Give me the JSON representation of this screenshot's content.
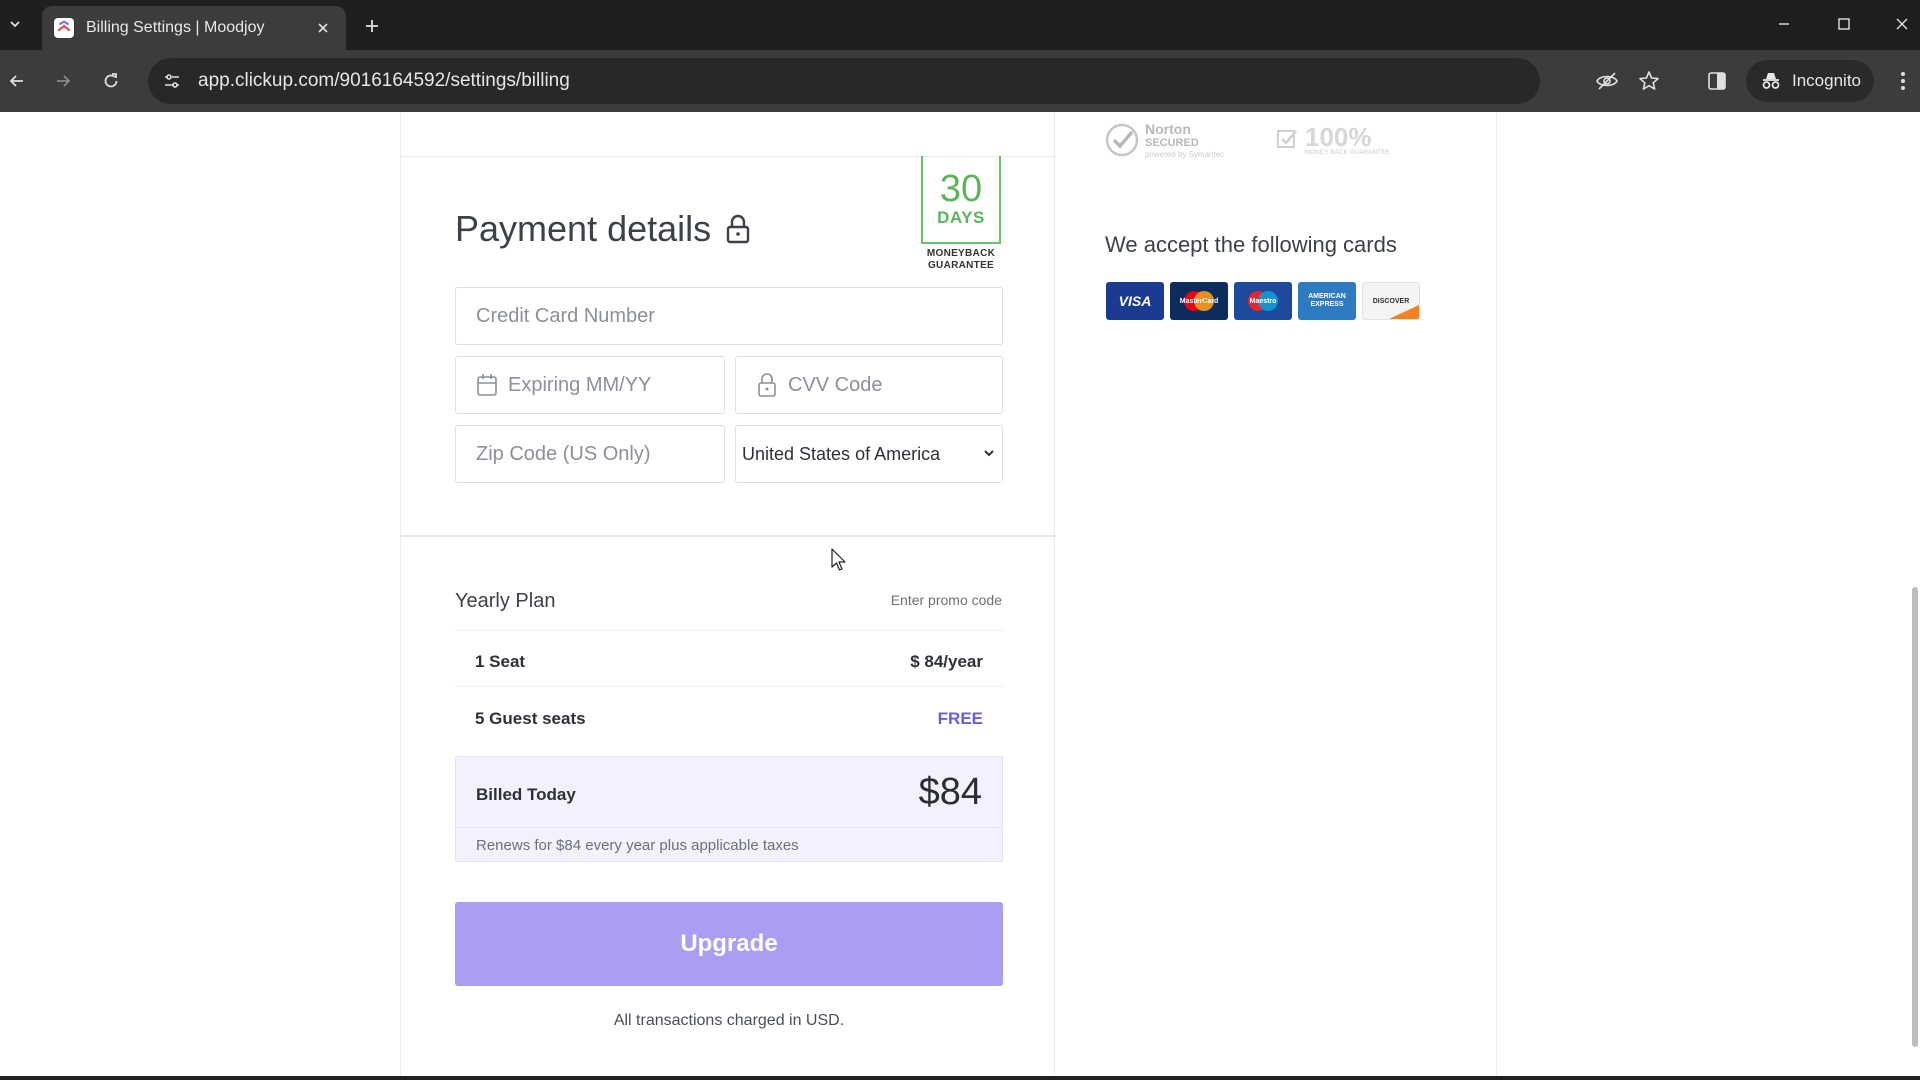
{
  "browser": {
    "tab_title": "Billing Settings | Moodjoy",
    "url": "app.clickup.com/9016164592/settings/billing",
    "incognito_label": "Incognito"
  },
  "guarantee": {
    "number": "30",
    "unit": "DAYS",
    "caption_line1": "MONEYBACK",
    "caption_line2": "GUARANTEE"
  },
  "payment": {
    "title": "Payment details",
    "card_number_placeholder": "Credit Card Number",
    "expiry_placeholder": "Expiring MM/YY",
    "cvv_placeholder": "CVV Code",
    "zip_placeholder": "Zip Code (US Only)",
    "country_selected": "United States of America"
  },
  "plan": {
    "title": "Yearly Plan",
    "promo_link": "Enter promo code",
    "rows": [
      {
        "label": "1 Seat",
        "value": "$ 84/year"
      },
      {
        "label": "5 Guest seats",
        "value": "FREE"
      }
    ],
    "billed_label": "Billed Today",
    "billed_amount": "$84",
    "renew_note": "Renews for $84 every year plus applicable taxes",
    "upgrade_label": "Upgrade",
    "currency_note": "All transactions charged in USD."
  },
  "trust": {
    "norton_title": "Norton",
    "norton_line2": "SECURED",
    "norton_sub": "powered by Symantec",
    "guarantee_pct": "100%",
    "guarantee_sub": "MONEY BACK GUARANTEE"
  },
  "cards": {
    "heading": "We accept the following cards",
    "list": [
      {
        "name": "VISA"
      },
      {
        "name": "MasterCard"
      },
      {
        "name": "Maestro"
      },
      {
        "name": "AMERICAN EXPRESS"
      },
      {
        "name": "DISCOVER"
      }
    ]
  },
  "colors": {
    "accent": "#a99ef3",
    "free": "#6b5fd6",
    "guarantee_green": "#5bb55a"
  }
}
